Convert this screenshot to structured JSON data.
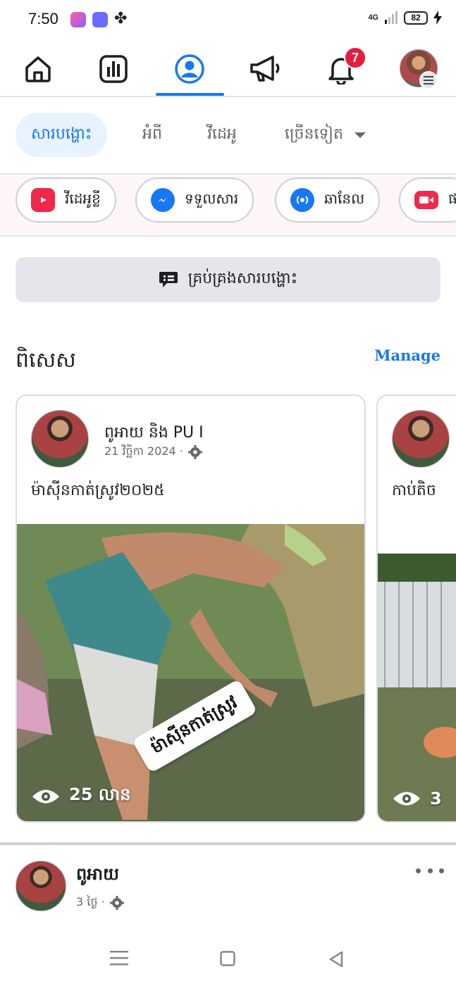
{
  "status_bar": {
    "time": "7:50",
    "network": "4G",
    "battery": "82"
  },
  "top_nav": {
    "items": [
      "home-icon",
      "insights-icon",
      "profile-icon",
      "megaphone-icon",
      "bell-icon",
      "avatar"
    ],
    "active": "profile-icon",
    "notification_count": "7"
  },
  "subtabs": {
    "posts": "សារបង្ហោះ",
    "about": "អំពី",
    "videos": "វីដេអូ",
    "more": "ច្រើនទៀត"
  },
  "pills": {
    "reels": "វីដេអូខ្លី",
    "messages": "ទទួលសារ",
    "channel": "ឆានែល",
    "live": "ផ"
  },
  "manage_posts": {
    "label": "គ្រប់គ្រងសារបង្ហោះ"
  },
  "featured": {
    "title": "ពិសេស",
    "manage_label": "Manage",
    "cards": [
      {
        "author": "ពូអាយ និង PU I",
        "date": "21 វិច្ឆិកា 2024 ·",
        "text": "ម៉ាស៊ីនកាត់ស្រូវ២០២៥",
        "sticker": "ម៉ាស៊ីនកាត់ស្រូវ",
        "views": "25 លាន"
      },
      {
        "text": "កាប់តិច",
        "views": "3"
      }
    ]
  },
  "post": {
    "author": "ពូអាយ",
    "meta": "3 ថ្ងៃ ·"
  },
  "colors": {
    "accent": "#1877f2",
    "badge": "#e41e3f",
    "reels": "#f02849",
    "messenger": "#1877f2"
  }
}
